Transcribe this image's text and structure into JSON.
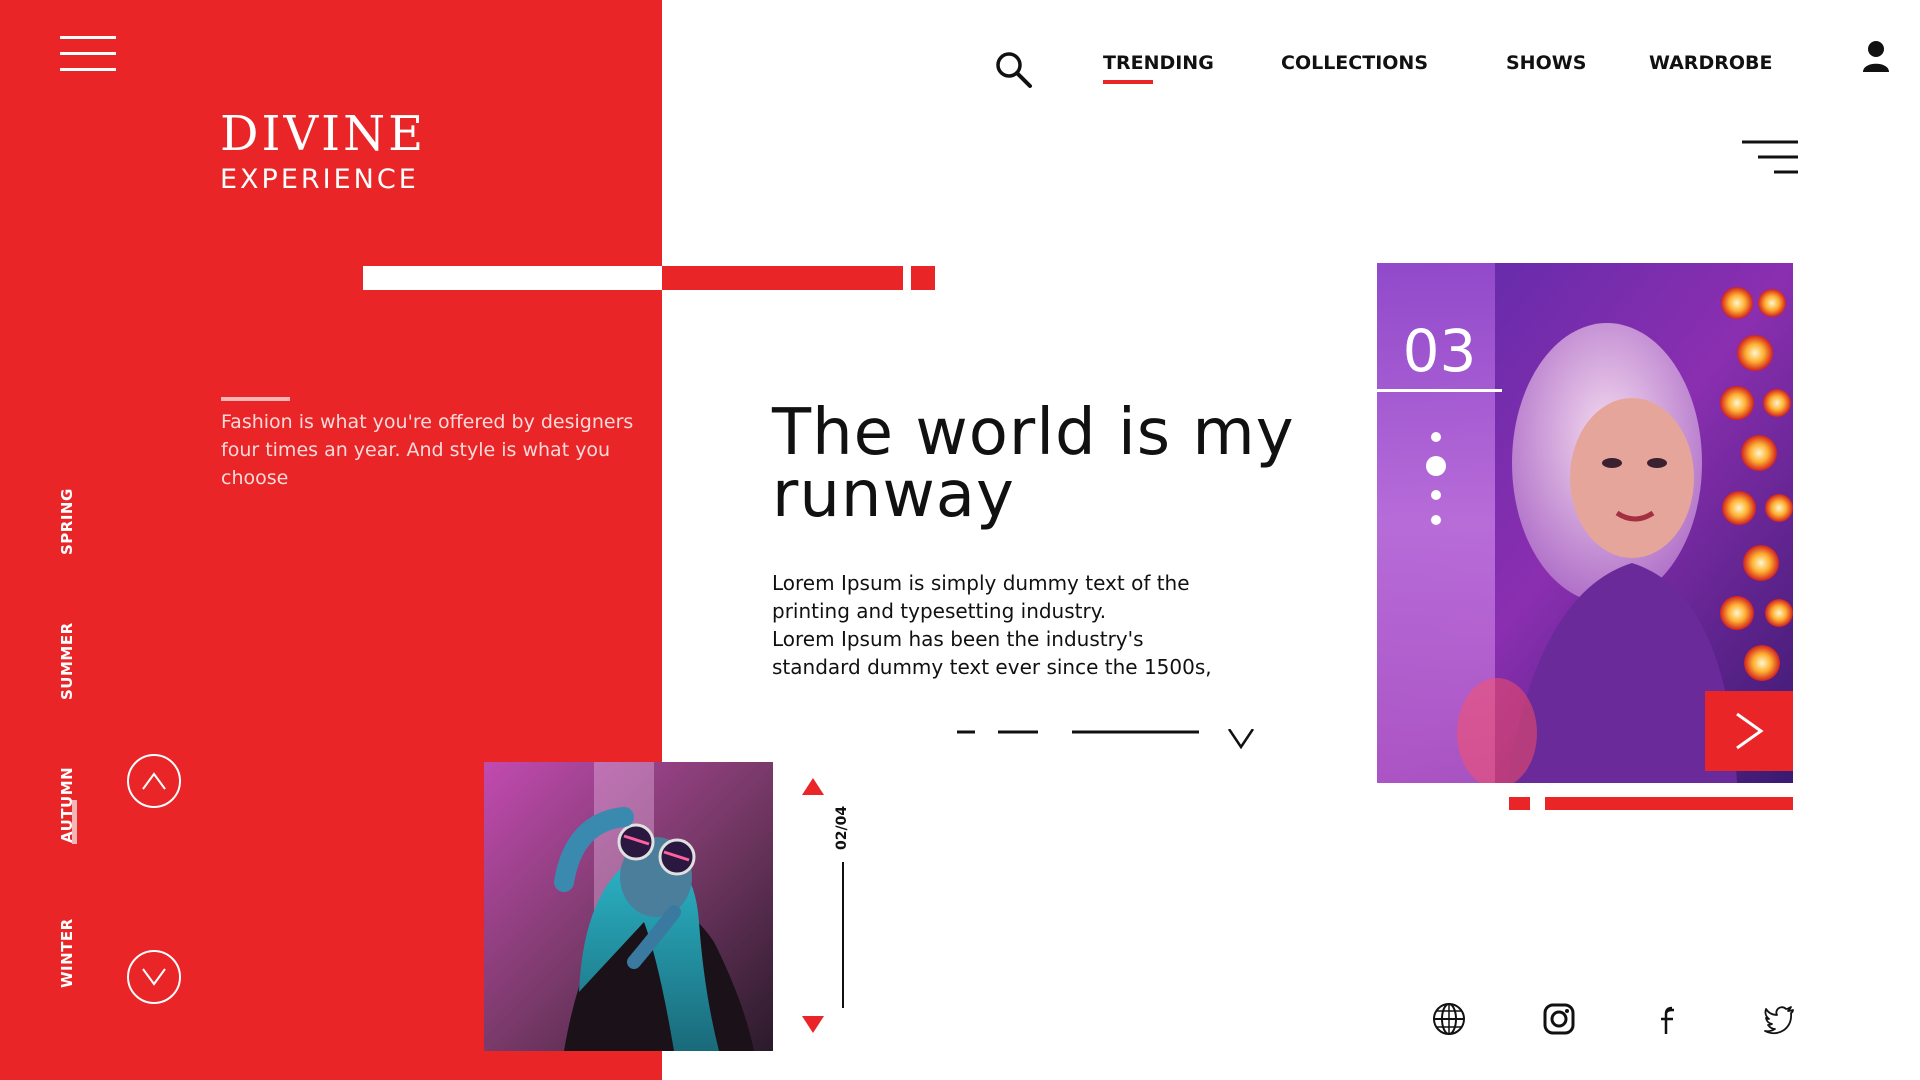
{
  "brand": {
    "title": "DIVINE",
    "subtitle": "EXPERIENCE"
  },
  "tagline": "Fashion is what you're offered by designers four times an year. And style is what you choose",
  "seasons": [
    {
      "label": "SPRING",
      "active": false
    },
    {
      "label": "SUMMER",
      "active": false
    },
    {
      "label": "AUTUMN",
      "active": true
    },
    {
      "label": "WINTER",
      "active": false
    }
  ],
  "nav": {
    "items": [
      {
        "label": "TRENDING",
        "active": true
      },
      {
        "label": "COLLECTIONS",
        "active": false
      },
      {
        "label": "SHOWS",
        "active": false
      },
      {
        "label": "WARDROBE",
        "active": false
      }
    ]
  },
  "hero": {
    "headline_line1": "The world is my",
    "headline_line2": "runway",
    "body_line1": "Lorem Ipsum is simply dummy text of the",
    "body_line2": "printing and typesetting industry.",
    "body_line3": "Lorem Ipsum has been the industry's",
    "body_line4": "standard dummy text ever since the 1500s,"
  },
  "slide": {
    "number": "03",
    "active_dot": 2,
    "dot_count": 4
  },
  "gallery": {
    "counter": "02/04"
  },
  "icons": {
    "menu": "hamburger-menu-icon",
    "search": "search-icon",
    "user": "user-icon",
    "filter": "filter-menu-icon",
    "scroll_down": "chevron-down-icon",
    "next": "chevron-right-icon",
    "up": "chevron-up-icon",
    "social": [
      "globe-icon",
      "instagram-icon",
      "facebook-icon",
      "twitter-icon"
    ]
  },
  "colors": {
    "accent": "#e92528",
    "text": "#111111",
    "background": "#ffffff"
  }
}
